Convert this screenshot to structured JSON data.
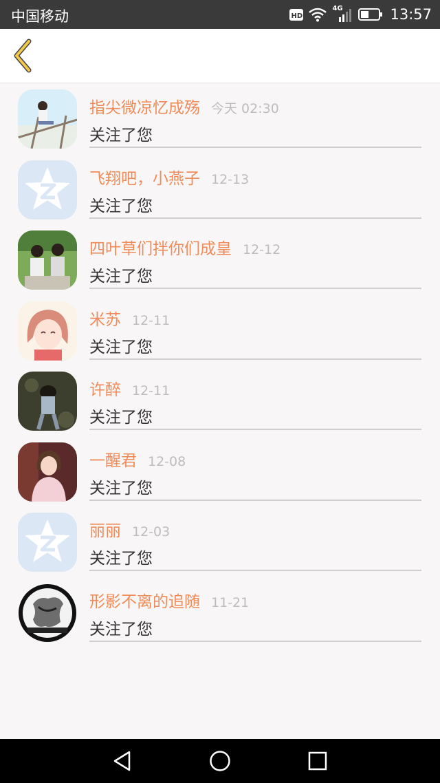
{
  "status_bar": {
    "carrier": "中国移动",
    "network": "4G",
    "hd_label": "HD",
    "time": "13:57",
    "icons": [
      "hd-icon",
      "wifi-icon",
      "signal-icon",
      "battery-icon"
    ]
  },
  "nav": {
    "back_icon": "chevron-left-icon"
  },
  "colors": {
    "accent": "#f08c5a",
    "date": "#bdbdbd",
    "back": "#f2c94c",
    "qq_avatar": "#dbe7f5"
  },
  "notifications": [
    {
      "name": "指尖微凉忆成殇",
      "date": "今天 02:30",
      "message": "关注了您",
      "avatar": "photo-boy-outdoor"
    },
    {
      "name": "飞翔吧，小燕子",
      "date": "12-13",
      "message": "关注了您",
      "avatar": "default-qq-avatar"
    },
    {
      "name": "四叶草们拌你们成皇",
      "date": "12-12",
      "message": "关注了您",
      "avatar": "photo-group"
    },
    {
      "name": "米苏",
      "date": "12-11",
      "message": "关注了您",
      "avatar": "anime-girl"
    },
    {
      "name": "许醉",
      "date": "12-11",
      "message": "关注了您",
      "avatar": "photo-dark"
    },
    {
      "name": "一醒君",
      "date": "12-08",
      "message": "关注了您",
      "avatar": "photo-person"
    },
    {
      "name": "丽丽",
      "date": "12-03",
      "message": "关注了您",
      "avatar": "default-qq-avatar"
    },
    {
      "name": "形影不离的追随",
      "date": "11-21",
      "message": "关注了您",
      "avatar": "sketch-round"
    }
  ],
  "bottom_nav": [
    "back-triangle-icon",
    "home-circle-icon",
    "recents-square-icon"
  ]
}
